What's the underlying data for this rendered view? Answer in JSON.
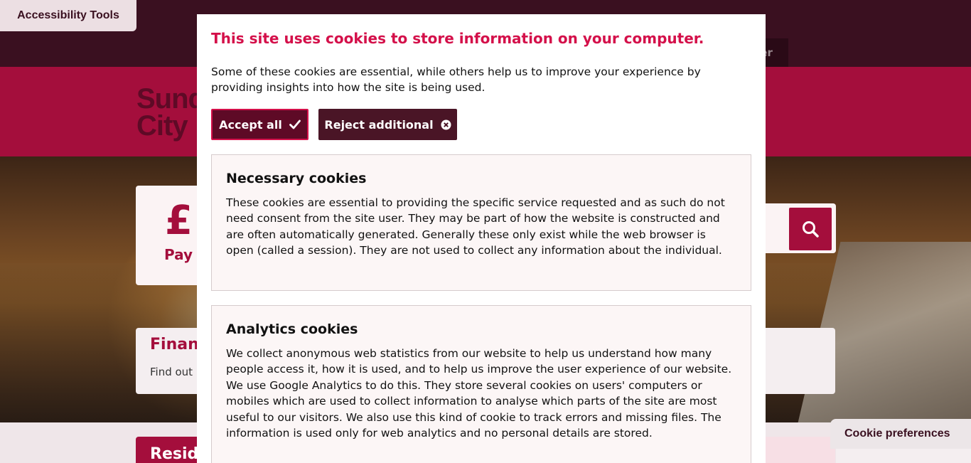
{
  "topbar": {
    "accessibility_label": "Accessibility Tools",
    "link_partial": "ter"
  },
  "header": {
    "logo_line1": "Sund",
    "logo_line2": "City"
  },
  "hero": {
    "pay_icon": "£",
    "pay_label": "Pay"
  },
  "finance": {
    "title": "Financ",
    "text": "Find out"
  },
  "resid": {
    "title": "Reside"
  },
  "cookie_preferences_label": "Cookie preferences",
  "modal": {
    "title": "This site uses cookies to store information on your computer.",
    "intro": "Some of these cookies are essential, while others help us to improve your experience by providing insights into how the site is being used.",
    "accept_label": "Accept all",
    "reject_label": "Reject additional",
    "sections": [
      {
        "title": "Necessary cookies",
        "body": "These cookies are essential to providing the specific service requested and as such do not need consent from the site user. They may be part of how the website is constructed and are often automatically generated. Generally these only exist while the web browser is open (called a session). They are not used to collect any information about the individual."
      },
      {
        "title": "Analytics cookies",
        "body": "We collect anonymous web statistics from our website to help us understand how many people access it, how it is used, and to help us improve the user experience of our website. We use Google Analytics to do this. They store several cookies on users' computers or mobiles which are used to collect information to analyse which parts of the site are most useful to our visitors. We also use this kind of cookie to track errors and missing files. The information is used only for web analytics and no personal details are stored."
      }
    ]
  },
  "colors": {
    "brand": "#a40e3c",
    "brand_dark": "#3a1020",
    "title_accent": "#d4104a"
  },
  "icons": {
    "search": "search-icon",
    "check": "check-icon",
    "reject": "close-circle-icon"
  }
}
